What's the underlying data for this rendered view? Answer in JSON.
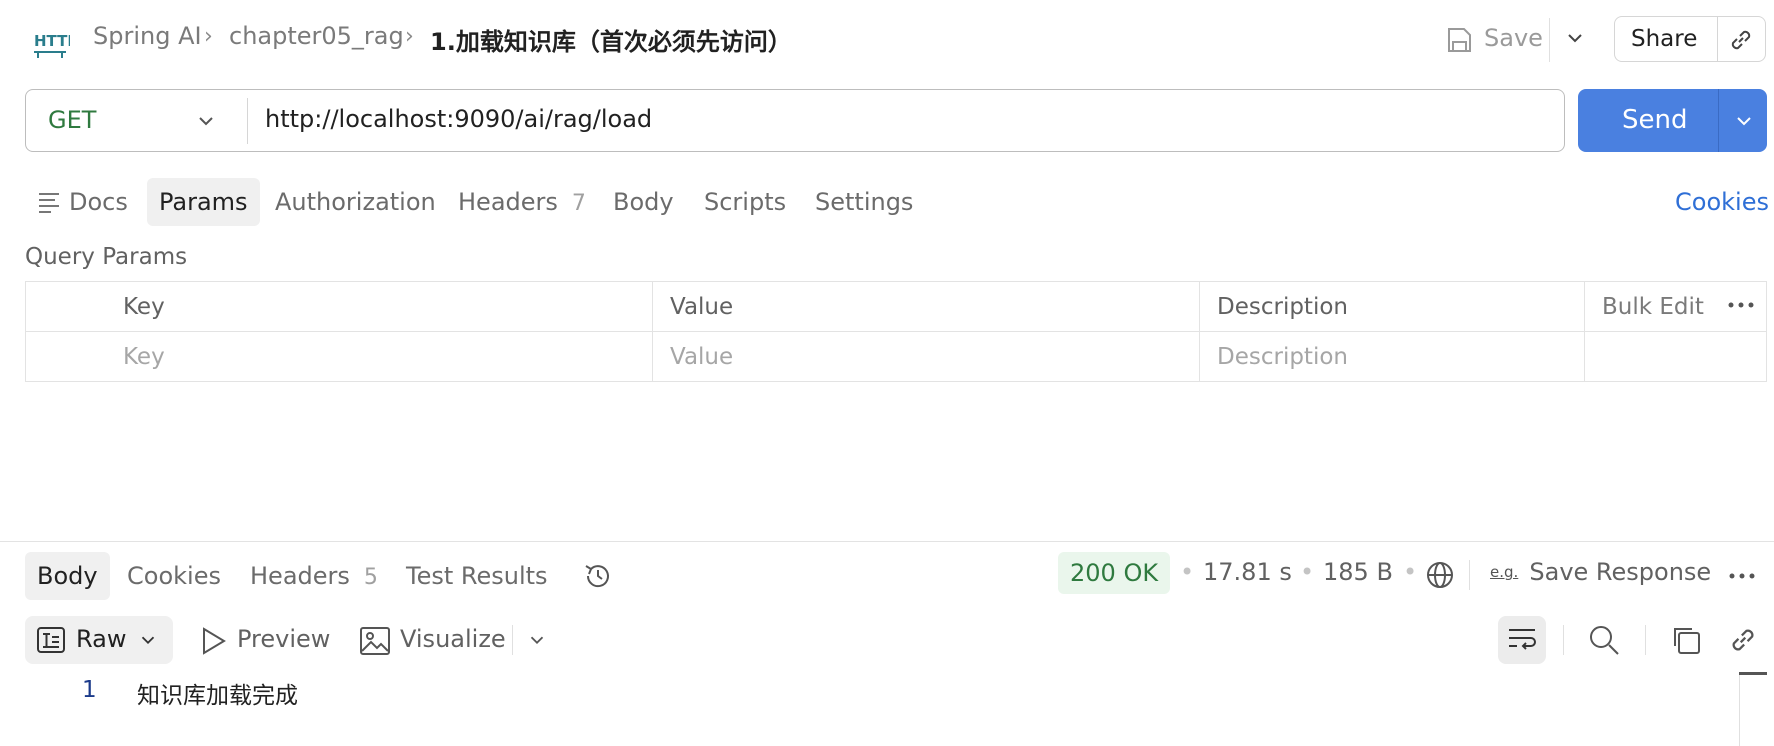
{
  "header": {
    "method_icon_label": "HTTP",
    "breadcrumb": [
      "Spring AI",
      "chapter05_rag",
      "1.加载知识库（首次必须先访问）"
    ],
    "save_label": "Save",
    "share_label": "Share"
  },
  "request": {
    "method": "GET",
    "url": "http://localhost:9090/ai/rag/load",
    "send_label": "Send"
  },
  "tabs": {
    "docs": "Docs",
    "params": "Params",
    "authorization": "Authorization",
    "headers": "Headers",
    "headers_count": "7",
    "body": "Body",
    "scripts": "Scripts",
    "settings": "Settings",
    "cookies": "Cookies"
  },
  "query_params": {
    "title": "Query Params",
    "columns": [
      "Key",
      "Value",
      "Description"
    ],
    "bulk_edit": "Bulk Edit",
    "placeholders": [
      "Key",
      "Value",
      "Description"
    ]
  },
  "response": {
    "tabs": {
      "body": "Body",
      "cookies": "Cookies",
      "headers": "Headers",
      "headers_count": "5",
      "test_results": "Test Results"
    },
    "status": "200 OK",
    "time": "17.81 s",
    "size": "185 B",
    "save_response": "Save Response",
    "save_response_icon_text": "e.g.",
    "view": {
      "raw": "Raw",
      "preview": "Preview",
      "visualize": "Visualize"
    },
    "lines": [
      {
        "number": "1",
        "text": "知识库加载完成"
      }
    ]
  },
  "colors": {
    "send": "#4a80e0",
    "method_get": "#2f7a3f",
    "status_ok": "#2f7a3f",
    "status_bg": "#eaf6ec",
    "link": "#2f6fd6",
    "http_icon": "#2a7d8c"
  }
}
